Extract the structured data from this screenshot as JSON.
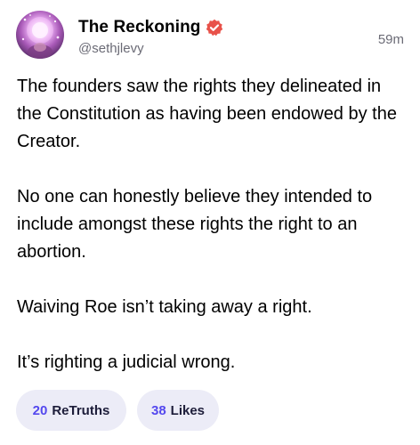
{
  "post": {
    "author": {
      "display_name": "The Reckoning",
      "handle": "@sethjlevy",
      "verified": true,
      "avatar_icon": "avatar-glowing-face"
    },
    "timestamp": "59m",
    "paragraphs": [
      "The founders saw the rights they delineated in the Constitution as having been endowed by the Creator.",
      "No one can honestly believe they intended to include amongst these rights the right to an abortion.",
      "Waiving Roe isn’t taking away a right.",
      "It’s righting a judicial wrong."
    ],
    "actions": {
      "retruths": {
        "count": "20",
        "label": "ReTruths"
      },
      "likes": {
        "count": "38",
        "label": "Likes"
      }
    }
  },
  "colors": {
    "accent": "#5448ee",
    "verified_badge": "#e8524a",
    "pill_background": "#ececf7",
    "secondary_text": "#6b6b76"
  }
}
